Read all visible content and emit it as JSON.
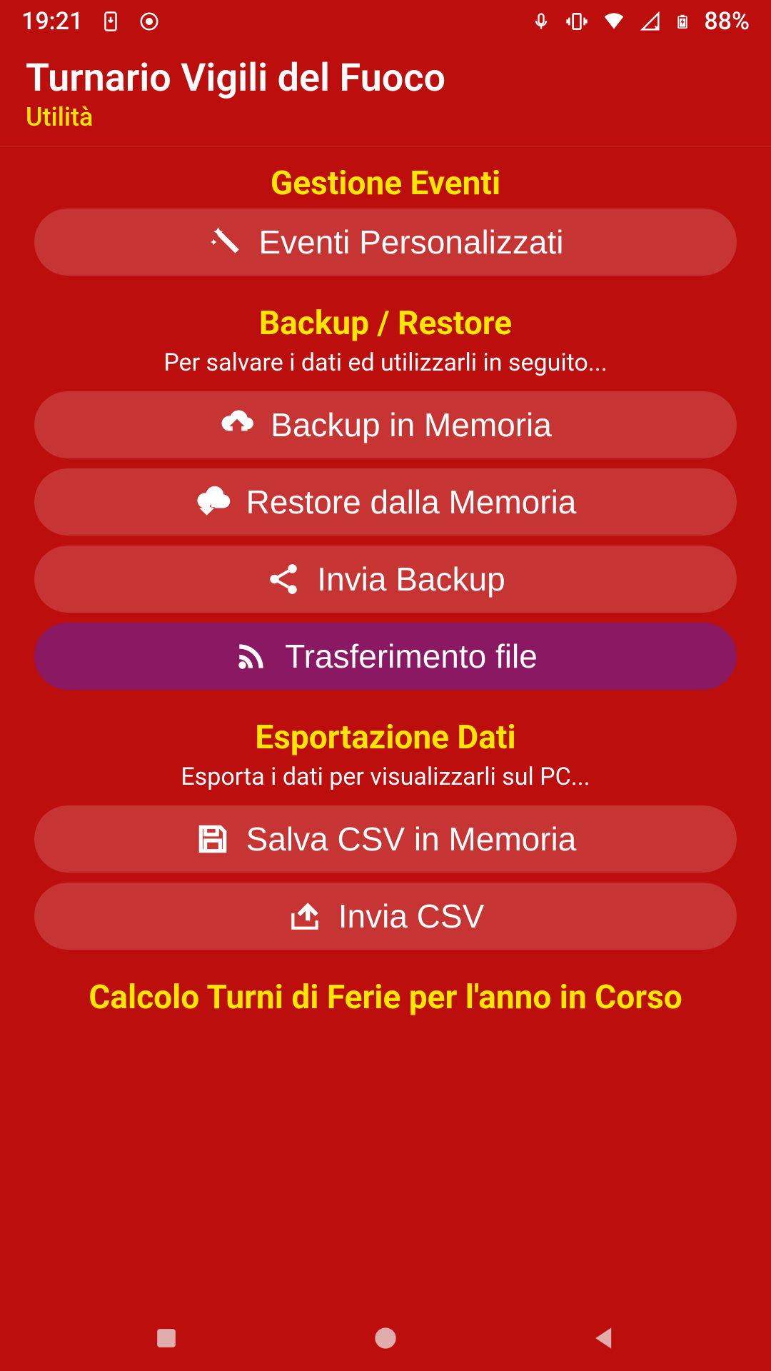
{
  "status": {
    "time": "19:21",
    "battery": "88%"
  },
  "header": {
    "title": "Turnario Vigili del Fuoco",
    "subtitle": "Utilità"
  },
  "sections": {
    "events": {
      "title": "Gestione Eventi",
      "custom_events": "Eventi Personalizzati"
    },
    "backup": {
      "title": "Backup / Restore",
      "desc": "Per salvare i dati ed utilizzarli in seguito...",
      "backup_mem": "Backup in Memoria",
      "restore_mem": "Restore dalla Memoria",
      "send_backup": "Invia Backup",
      "transfer": "Trasferimento file"
    },
    "export": {
      "title": "Esportazione Dati",
      "desc": "Esporta i dati per visualizzarli sul PC...",
      "save_csv": "Salva CSV in Memoria",
      "send_csv": "Invia CSV"
    },
    "partial": {
      "title": "Calcolo Turni di Ferie per l'anno in Corso"
    }
  }
}
